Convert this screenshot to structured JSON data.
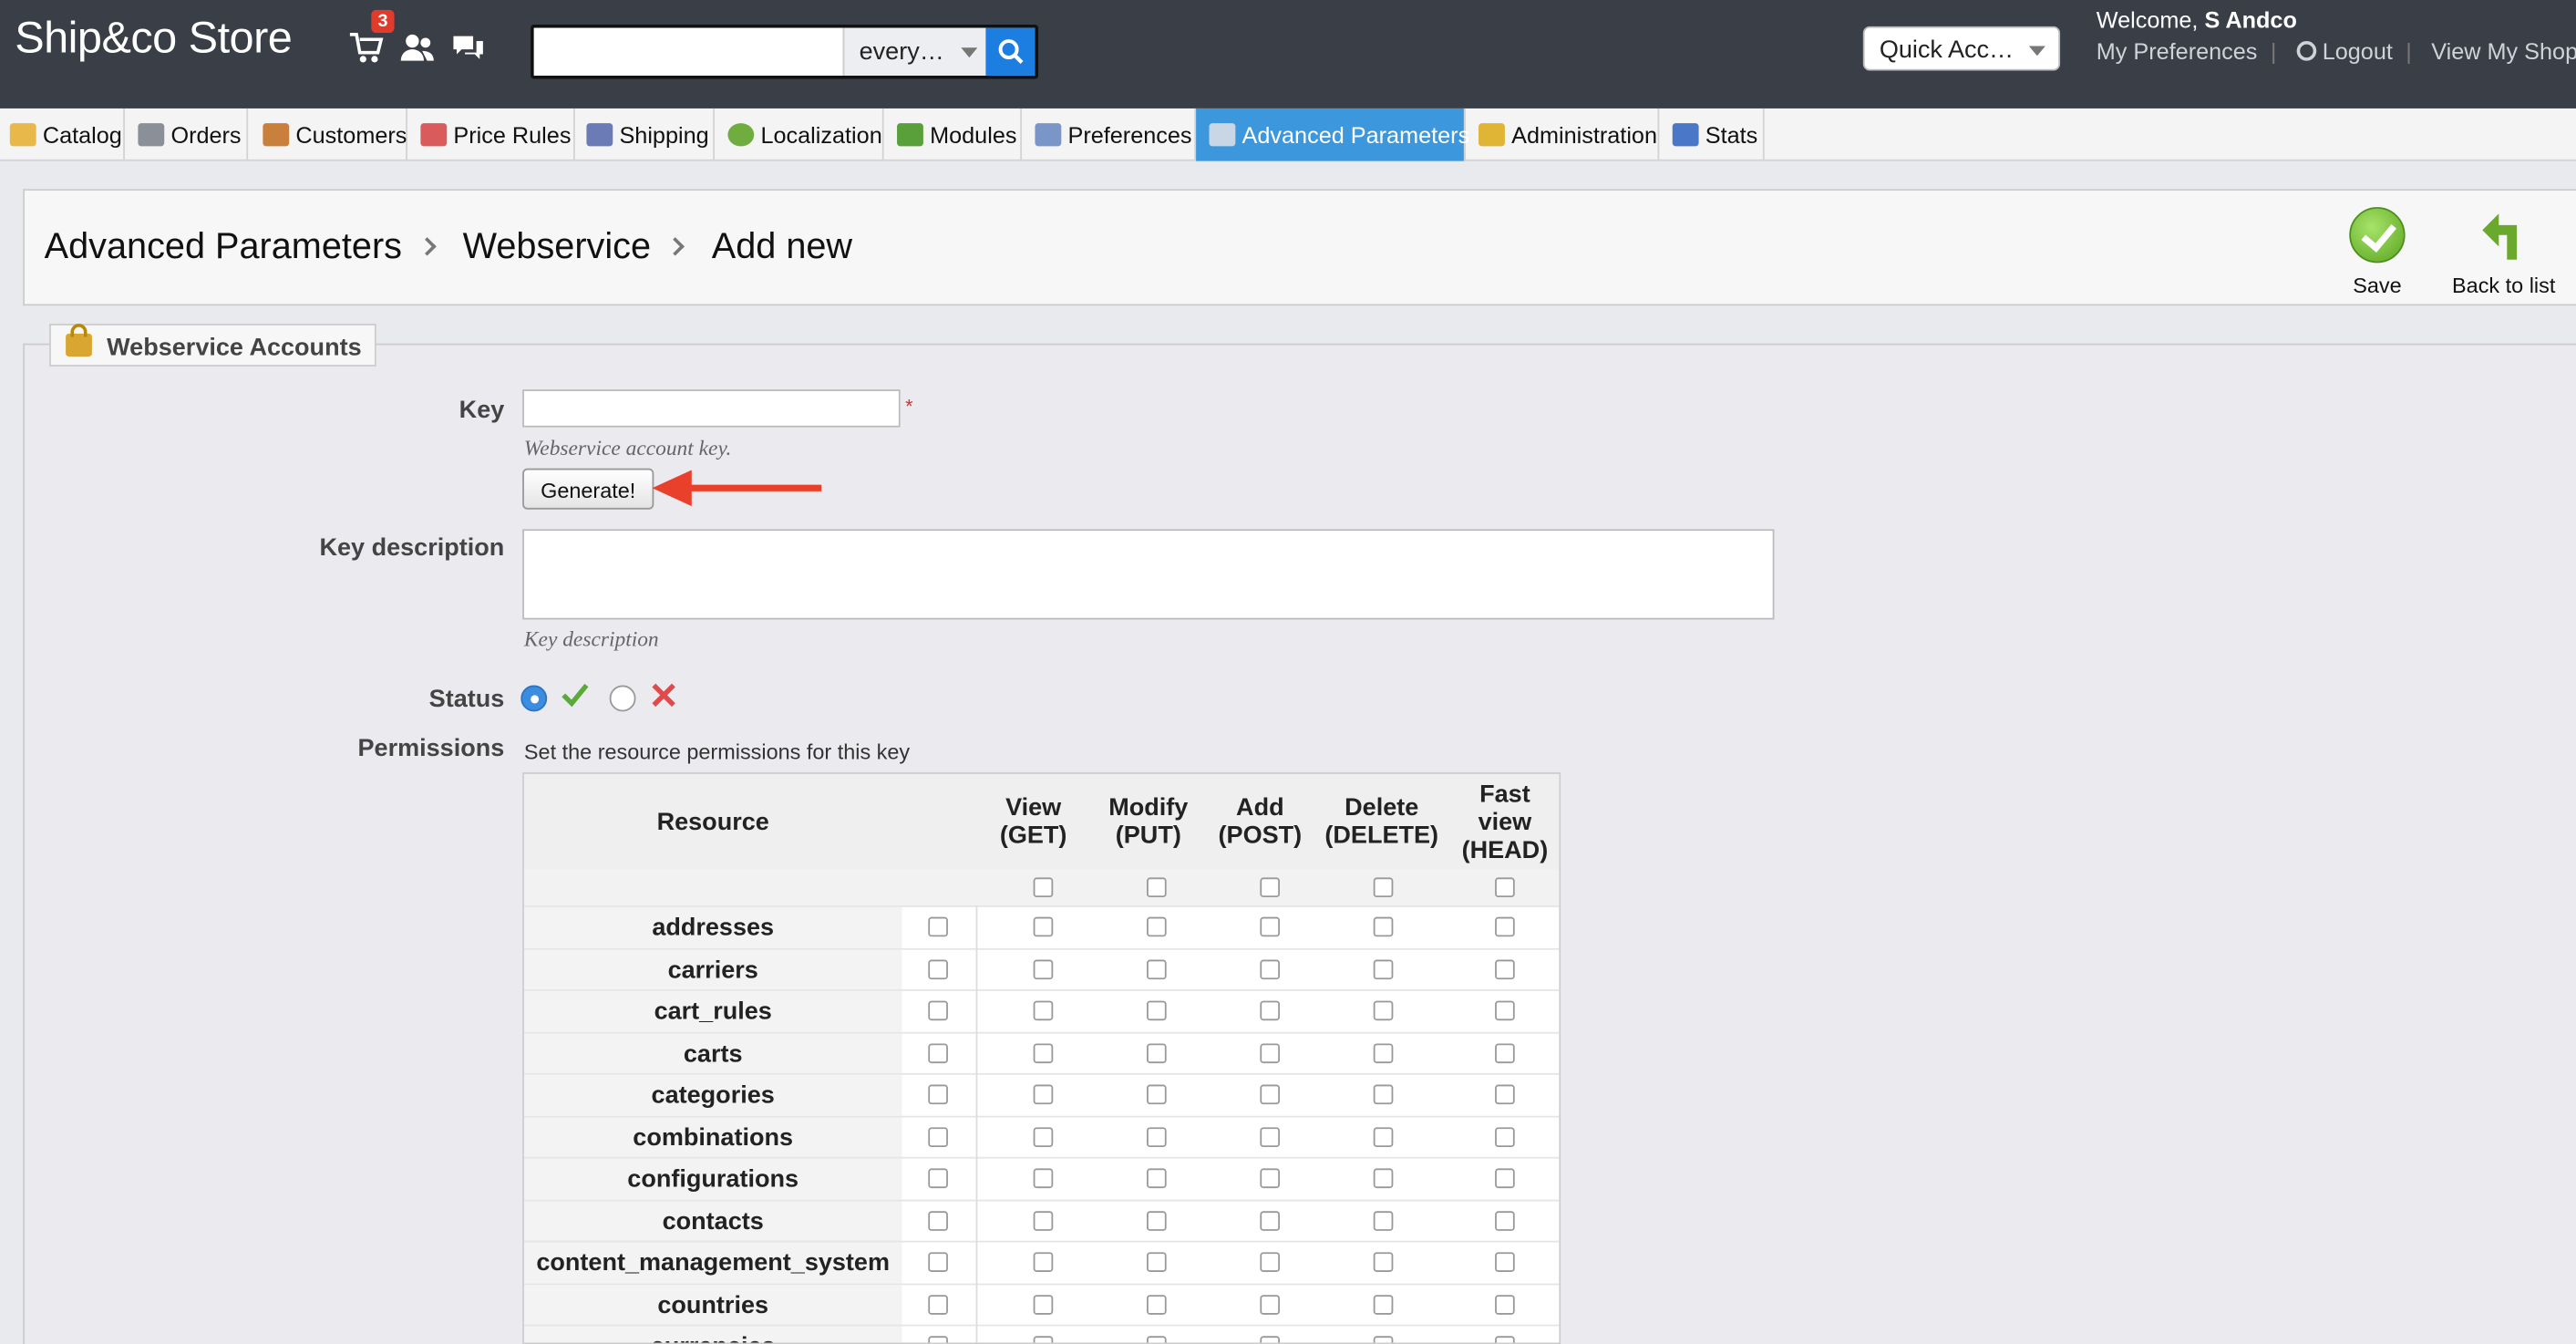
{
  "header": {
    "shop_name": "Ship&co Store",
    "cart_badge": "3",
    "search": {
      "value": "",
      "scope": "every…"
    },
    "quick_access": "Quick Acc…",
    "welcome_prefix": "Welcome,",
    "user_name": "S Andco",
    "links": {
      "preferences": "My Preferences",
      "logout": "Logout",
      "view_shop": "View My Shop"
    }
  },
  "tabs": [
    {
      "label": "Catalog",
      "color": "#e8b84a"
    },
    {
      "label": "Orders",
      "color": "#8a8f98"
    },
    {
      "label": "Customers",
      "color": "#c9803c"
    },
    {
      "label": "Price Rules",
      "color": "#d95b5b"
    },
    {
      "label": "Shipping",
      "color": "#6a7bb5"
    },
    {
      "label": "Localization",
      "color": "#6fae3e"
    },
    {
      "label": "Modules",
      "color": "#5aa03a"
    },
    {
      "label": "Preferences",
      "color": "#7a96c8"
    },
    {
      "label": "Advanced Parameters",
      "color": "#c9d6e6",
      "active": true
    },
    {
      "label": "Administration",
      "color": "#e0b435"
    },
    {
      "label": "Stats",
      "color": "#4a77c8"
    }
  ],
  "toolbar": {
    "breadcrumb": [
      "Advanced Parameters",
      "Webservice",
      "Add new"
    ],
    "save_label": "Save",
    "back_label": "Back to list"
  },
  "form": {
    "legend": "Webservice Accounts",
    "key_label": "Key",
    "key_value": "",
    "key_required": "*",
    "key_help": "Webservice account key.",
    "generate_label": "Generate!",
    "desc_label": "Key description",
    "desc_value": "",
    "desc_help": "Key description",
    "status_label": "Status",
    "status_enabled": true,
    "permissions_label": "Permissions",
    "permissions_note": "Set the resource permissions for this key"
  },
  "permissions_table": {
    "headers": {
      "resource": "Resource",
      "get": [
        "View",
        "(GET)"
      ],
      "put": [
        "Modify",
        "(PUT)"
      ],
      "post": [
        "Add",
        "(POST)"
      ],
      "delete": [
        "Delete",
        "(DELETE)"
      ],
      "head": [
        "Fast",
        "view",
        "(HEAD)"
      ]
    },
    "resources": [
      "addresses",
      "carriers",
      "cart_rules",
      "carts",
      "categories",
      "combinations",
      "configurations",
      "contacts",
      "content_management_system",
      "countries",
      "currencies"
    ]
  },
  "colors": {
    "header_bg": "#393e47",
    "active_tab": "#3c97dd",
    "accent_arrow": "#e8402a",
    "search_btn": "#1b7ee0"
  }
}
